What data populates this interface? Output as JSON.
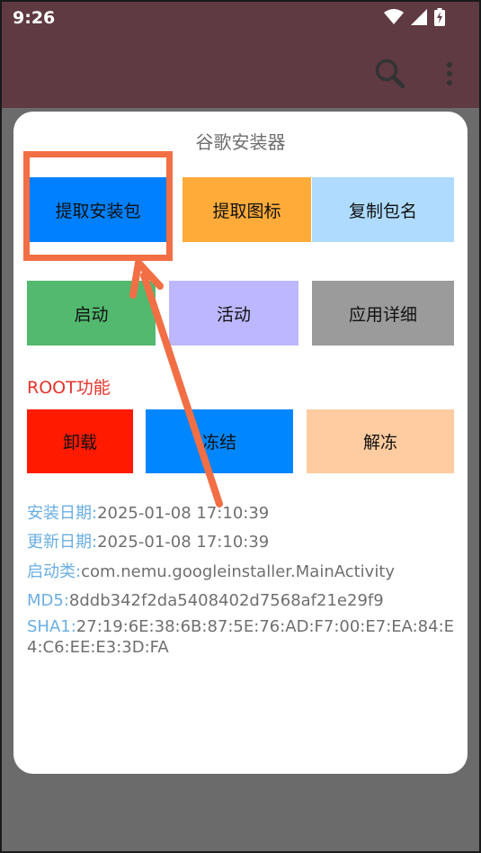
{
  "status_bar": {
    "time": "9:26",
    "icons": [
      "wifi-icon",
      "signal-icon",
      "battery-charging-icon"
    ]
  },
  "app_bar": {
    "icons": [
      "search-icon",
      "more-vert-icon"
    ]
  },
  "dialog": {
    "title": "谷歌安装器",
    "row1": [
      {
        "label": "提取安装包",
        "color": "#0080ff"
      },
      {
        "label": "提取图标",
        "color": "#ffab3a"
      },
      {
        "label": "复制包名",
        "color": "#aedbff"
      }
    ],
    "row2": [
      {
        "label": "启动",
        "color": "#52b96f"
      },
      {
        "label": "活动",
        "color": "#bdb7ff"
      },
      {
        "label": "应用详细",
        "color": "#9b9b9b"
      }
    ],
    "root_label": "ROOT功能",
    "row3": [
      {
        "label": "卸载",
        "color": "#ff1a00"
      },
      {
        "label": "冻结",
        "color": "#0086ff"
      },
      {
        "label": "解冻",
        "color": "#ffcba0"
      }
    ],
    "info": {
      "install_key": "安装日期:",
      "install_val": "2025-01-08 17:10:39",
      "update_key": "更新日期:",
      "update_val": "2025-01-08 17:10:39",
      "launch_key": "启动类:",
      "launch_val": "com.nemu.googleinstaller.MainActivity",
      "md5_key": "MD5:",
      "md5_val": "8ddb342f2da5408402d7568af21e29f9",
      "sha1_key": "SHA1:",
      "sha1_val": "27:19:6E:38:6B:87:5E:76:AD:F7:00:E7:EA:84:E4:C6:EE:E3:3D:FA"
    }
  },
  "annotation": {
    "color": "#f26f45"
  }
}
